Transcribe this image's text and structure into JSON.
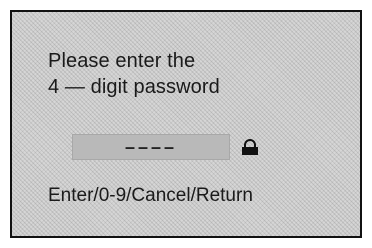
{
  "dialog": {
    "prompt_line1": "Please enter the",
    "prompt_line2": "4 — digit password",
    "password_placeholder": "––––",
    "lock_icon": "lock-icon",
    "hint": "Enter/0-9/Cancel/Return"
  }
}
